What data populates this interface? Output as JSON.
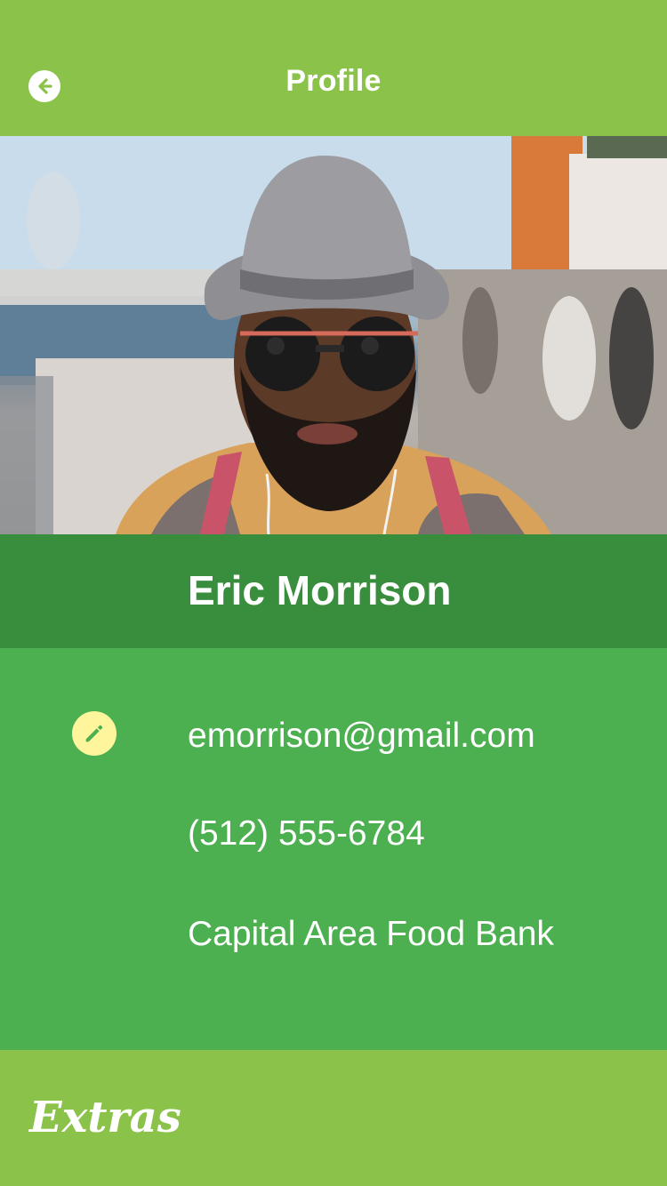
{
  "header": {
    "title": "Profile",
    "back_icon": "arrow-left-circle-icon"
  },
  "profile": {
    "name": "Eric Morrison",
    "photo_alt": "Profile photo",
    "email": "emorrison@gmail.com",
    "phone": "(512) 555-6784",
    "organization": "Capital Area Food Bank",
    "edit_icon": "pencil-icon"
  },
  "footer": {
    "extras_label": "Extras"
  },
  "colors": {
    "header_bg": "#8bc34a",
    "name_bar_bg": "#388e3c",
    "details_bg": "#4caf50",
    "edit_badge_bg": "#fff59d",
    "edit_icon": "#4caf50"
  }
}
